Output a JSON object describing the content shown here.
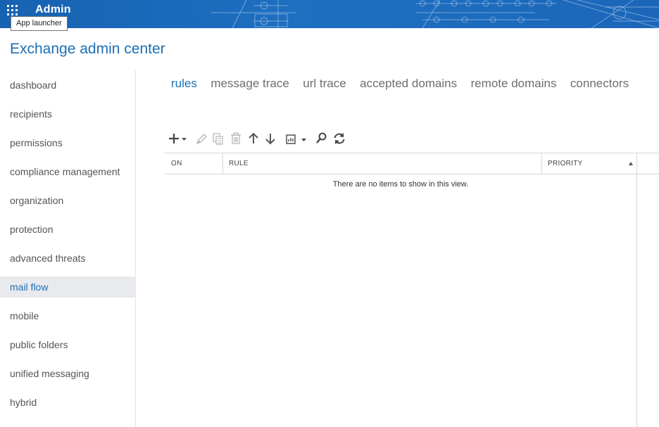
{
  "banner": {
    "title": "Admin",
    "launcher_tooltip": "App launcher",
    "bg_color": "#1a67b8"
  },
  "app": {
    "title": "Exchange admin center",
    "accent_color": "#1b6fb5"
  },
  "nav": {
    "items": [
      {
        "label": "dashboard"
      },
      {
        "label": "recipients"
      },
      {
        "label": "permissions"
      },
      {
        "label": "compliance management"
      },
      {
        "label": "organization"
      },
      {
        "label": "protection"
      },
      {
        "label": "advanced threats"
      },
      {
        "label": "mail flow",
        "active": true
      },
      {
        "label": "mobile"
      },
      {
        "label": "public folders"
      },
      {
        "label": "unified messaging"
      },
      {
        "label": "hybrid"
      }
    ]
  },
  "tabs": [
    {
      "label": "rules",
      "active": true
    },
    {
      "label": "message trace"
    },
    {
      "label": "url trace"
    },
    {
      "label": "accepted domains"
    },
    {
      "label": "remote domains"
    },
    {
      "label": "connectors"
    }
  ],
  "toolbar": {
    "items": [
      "add-icon",
      "edit-icon",
      "copy-icon",
      "delete-icon",
      "move-up-icon",
      "move-down-icon",
      "report-icon",
      "search-icon",
      "refresh-icon"
    ]
  },
  "grid": {
    "columns": [
      {
        "label": "ON"
      },
      {
        "label": "RULE"
      },
      {
        "label": "PRIORITY",
        "sorted": "ascending"
      }
    ],
    "rows": [],
    "empty_message": "There are no items to show in this view."
  }
}
